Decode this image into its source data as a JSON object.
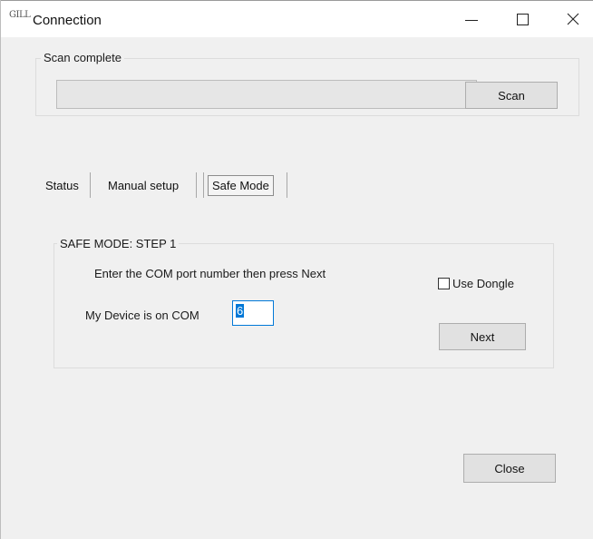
{
  "window": {
    "app_icon": "GILL",
    "title": "Connection"
  },
  "scan": {
    "group_label": "Scan complete",
    "progress": 0,
    "button_label": "Scan"
  },
  "tabs": [
    {
      "label": "Status"
    },
    {
      "label": "Manual setup"
    },
    {
      "label": "Safe Mode",
      "active": true
    }
  ],
  "safe_mode": {
    "group_label": "SAFE MODE: STEP 1",
    "instruction": "Enter the COM port number then press Next",
    "com_label": "My Device is on COM",
    "com_value": "6",
    "dongle_label": "Use Dongle",
    "dongle_checked": false,
    "next_label": "Next"
  },
  "footer": {
    "close_label": "Close"
  },
  "colors": {
    "focus_accent": "#0078d7",
    "button_face": "#e1e1e1"
  }
}
